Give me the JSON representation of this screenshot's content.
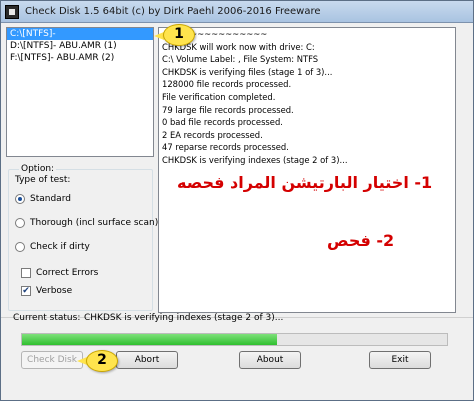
{
  "window": {
    "title": "Check Disk 1.5 64bit (c) by Dirk Paehl  2006-2016 Freeware"
  },
  "drives": [
    {
      "label": "C:\\[NTFS]-",
      "selected": true
    },
    {
      "label": "D:\\[NTFS]- ABU.AMR (1)",
      "selected": false
    },
    {
      "label": "F:\\[NTFS]- ABU.AMR (2)",
      "selected": false
    }
  ],
  "log": [
    "~~~~~~~~~~~~~~~",
    "CHKDSK will work now with drive: C:",
    "C:\\ Volume Label: , File System: NTFS",
    "CHKDSK is verifying files (stage 1 of 3)...",
    "128000 file records processed.",
    "File verification completed.",
    "79 large file records processed.",
    "0 bad file records processed.",
    "2 EA records processed.",
    "47 reparse records processed.",
    "CHKDSK is verifying indexes (stage 2 of 3)..."
  ],
  "options": {
    "group_label": "Option:",
    "test_type_label": "Type of test:",
    "radios": [
      {
        "label": "Standard",
        "checked": true
      },
      {
        "label": "Thorough (incl surface scan)",
        "checked": false
      },
      {
        "label": "Check if dirty",
        "checked": false
      }
    ],
    "checkboxes": [
      {
        "label": "Correct Errors",
        "checked": false
      },
      {
        "label": "Verbose",
        "checked": true
      }
    ]
  },
  "annotations": {
    "step1": "1- اختيار البارتيشن المراد فحصه",
    "step2": "2- فحص",
    "callout1": "1",
    "callout2": "2"
  },
  "status": {
    "label": "Current status:",
    "text": "CHKDSK is verifying indexes (stage 2 of 3)...",
    "progress_fraction": 0.6
  },
  "buttons": {
    "check_disk": "Check Disk",
    "abort": "Abort",
    "about": "About",
    "exit": "Exit"
  },
  "colors": {
    "selection": "#3399ff",
    "progress": "#2fbf2f",
    "annotation": "#d40000",
    "callout": "#ffe44d"
  }
}
